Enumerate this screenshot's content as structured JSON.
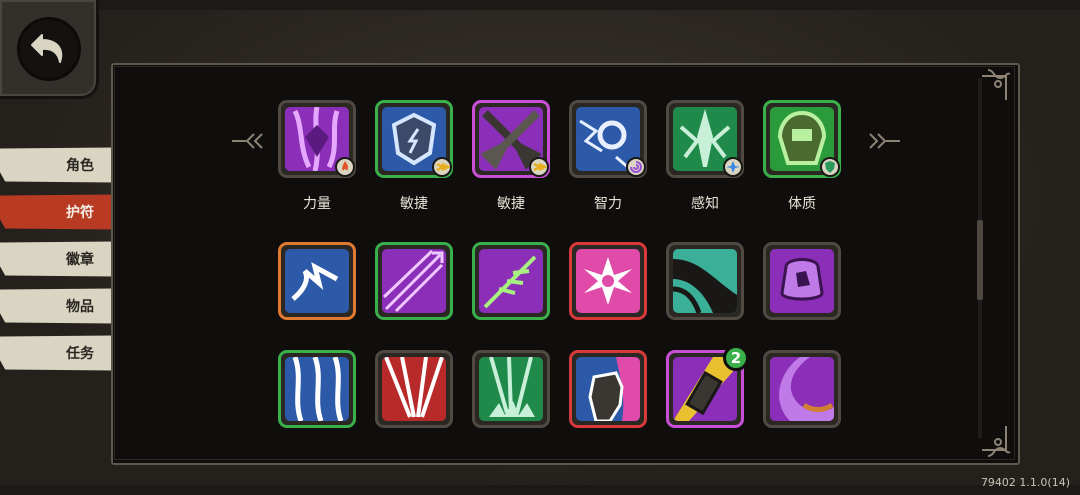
{
  "sidebar": {
    "items": [
      {
        "label": "角色",
        "active": false
      },
      {
        "label": "护符",
        "active": true
      },
      {
        "label": "徽章",
        "active": false
      },
      {
        "label": "物品",
        "active": false
      },
      {
        "label": "任务",
        "active": false
      }
    ]
  },
  "grid": {
    "row1": [
      {
        "caption": "力量",
        "frame": "#9a8d7a",
        "bg": "#8b2fb8",
        "fg": "#e6a8ff",
        "badge_icon": "fire-icon",
        "badge_color": "#e0522a"
      },
      {
        "caption": "敏捷",
        "frame": "#3ab04a",
        "bg": "#2c5aa8",
        "fg": "#d6e6ff",
        "badge_icon": "dash-icon",
        "badge_color": "#e8b020"
      },
      {
        "caption": "敏捷",
        "frame": "#c84fd6",
        "bg": "#8b2fb8",
        "fg": "#3a3632",
        "badge_icon": "dash-icon",
        "badge_color": "#e8b020"
      },
      {
        "caption": "智力",
        "frame": "#9a8d7a",
        "bg": "#2c5aa8",
        "fg": "#e8f0ff",
        "badge_icon": "swirl-icon",
        "badge_color": "#9a50d8"
      },
      {
        "caption": "感知",
        "frame": "#9a8d7a",
        "bg": "#1f8a4a",
        "fg": "#c8f0d8",
        "badge_icon": "star-icon",
        "badge_color": "#3a86e0"
      },
      {
        "caption": "体质",
        "frame": "#3ab04a",
        "bg": "#2a9a3a",
        "fg": "#b8f0a0",
        "badge_icon": "shield-icon",
        "badge_color": "#2a9a5a"
      }
    ],
    "row2": [
      {
        "frame": "#e07a30",
        "bg": "#2c5aa8",
        "fg": "#ffffff",
        "icon": "wind-slash-icon"
      },
      {
        "frame": "#3ab04a",
        "bg": "#8b2fb8",
        "fg": "#f0c8ff",
        "icon": "arrow-volley-icon"
      },
      {
        "frame": "#3ab04a",
        "bg": "#8b2fb8",
        "fg": "#a8f080",
        "icon": "thorn-arrow-icon"
      },
      {
        "frame": "#d83a3a",
        "bg": "#e04aa8",
        "fg": "#ffffff",
        "icon": "radiant-burst-icon"
      },
      {
        "frame": "#9a8d7a",
        "bg": "#3ab098",
        "fg": "#1a1816",
        "icon": "claw-slash-icon"
      },
      {
        "frame": "#9a8d7a",
        "bg": "#8b2fb8",
        "fg": "#c07ae8",
        "icon": "skull-spirit-icon"
      }
    ],
    "row3": [
      {
        "frame": "#3ab04a",
        "bg": "#2c5aa8",
        "fg": "#ffffff",
        "icon": "claw-rake-icon"
      },
      {
        "frame": "#9a8d7a",
        "bg": "#b82a2a",
        "fg": "#ffffff",
        "icon": "blade-storm-icon"
      },
      {
        "frame": "#9a8d7a",
        "bg": "#1f8a4a",
        "fg": "#c8f0d8",
        "icon": "ground-spikes-icon"
      },
      {
        "frame": "#d83a3a",
        "bg": "#2c5aa8",
        "fg": "#ffffff",
        "icon": "iron-fist-icon"
      },
      {
        "frame": "#c84fd6",
        "bg": "#8b2fb8",
        "fg": "#e8c030",
        "icon": "lantern-item-icon",
        "count": "2"
      },
      {
        "frame": "#9a8d7a",
        "bg": "#8b2fb8",
        "fg": "#d08030",
        "icon": "tentacle-icon"
      }
    ]
  },
  "version": "79402 1.1.0(14)"
}
